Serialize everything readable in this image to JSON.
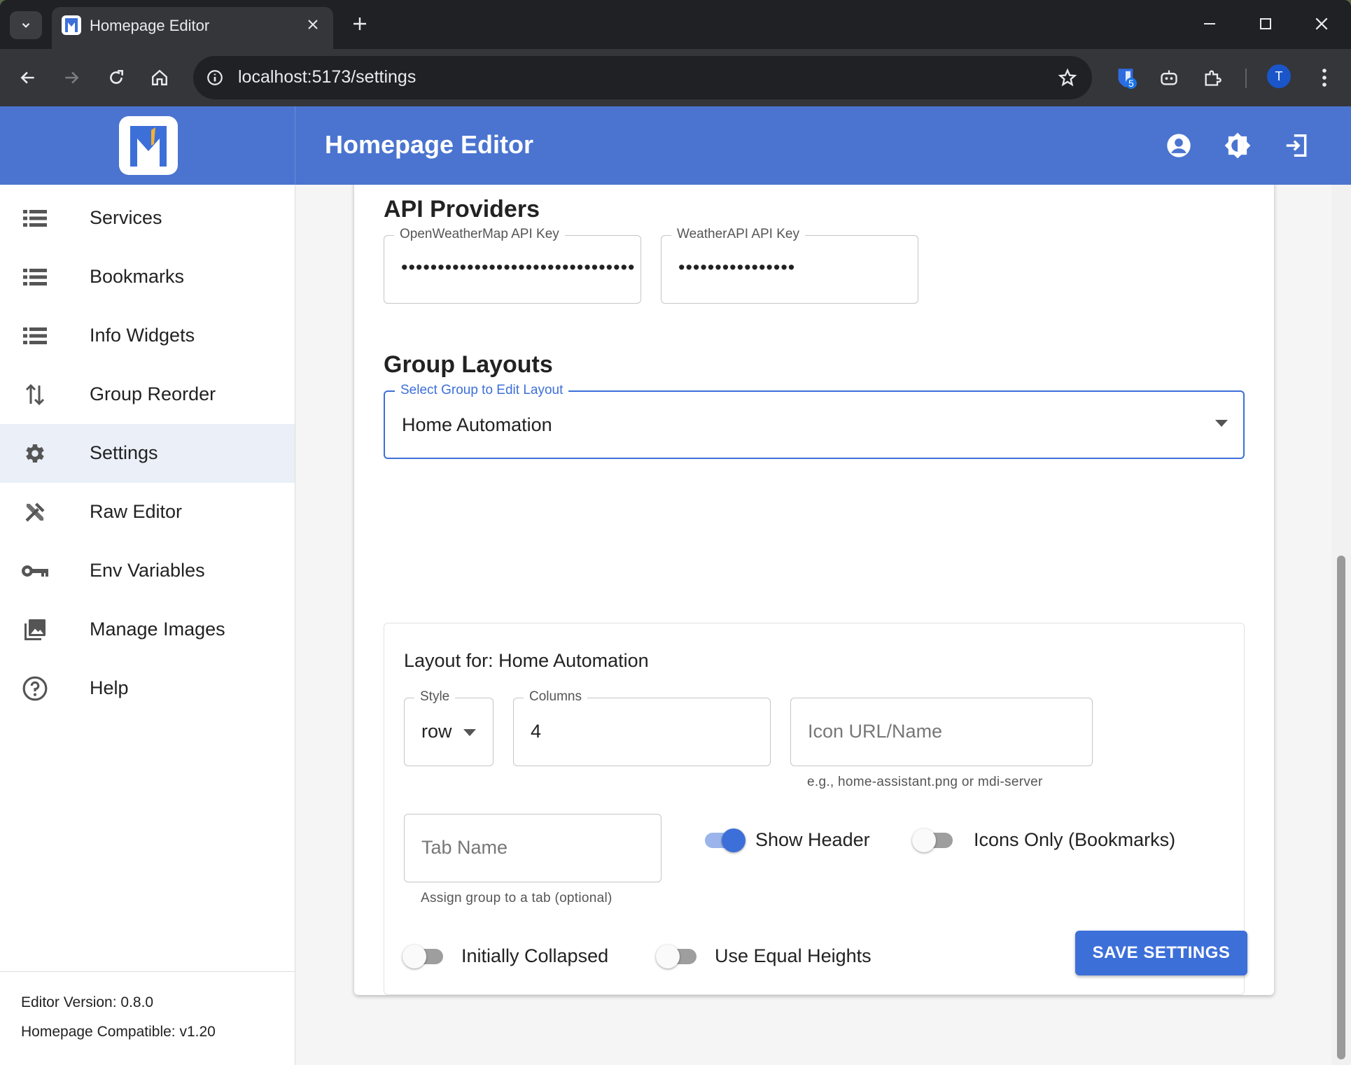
{
  "browser": {
    "tab_title": "Homepage Editor",
    "url": "localhost:5173/settings",
    "extension_badge": "5",
    "profile_initial": "T"
  },
  "app": {
    "title": "Homepage Editor",
    "accent_color": "#4a74d0"
  },
  "sidebar": {
    "items": [
      {
        "label": "Services",
        "icon": "list-icon"
      },
      {
        "label": "Bookmarks",
        "icon": "list-icon"
      },
      {
        "label": "Info Widgets",
        "icon": "list-icon"
      },
      {
        "label": "Group Reorder",
        "icon": "swap-vertical-icon"
      },
      {
        "label": "Settings",
        "icon": "gear-icon"
      },
      {
        "label": "Raw Editor",
        "icon": "tools-icon"
      },
      {
        "label": "Env Variables",
        "icon": "key-icon"
      },
      {
        "label": "Manage Images",
        "icon": "image-icon"
      },
      {
        "label": "Help",
        "icon": "help-circle-icon"
      }
    ],
    "active": "Settings",
    "footer": {
      "editor_version": "Editor Version: 0.8.0",
      "compatible": "Homepage Compatible: v1.20"
    }
  },
  "api_providers": {
    "title": "API Providers",
    "openweathermap": {
      "label": "OpenWeatherMap API Key",
      "value": "••••••••••••••••••••••••••••••••"
    },
    "weatherapi": {
      "label": "WeatherAPI API Key",
      "value": "••••••••••••••••"
    }
  },
  "group_layouts": {
    "title": "Group Layouts",
    "select_label": "Select Group to Edit Layout",
    "selected_group": "Home Automation",
    "layout_title": "Layout for: Home Automation",
    "style": {
      "label": "Style",
      "value": "row"
    },
    "columns": {
      "label": "Columns",
      "value": "4"
    },
    "icon": {
      "placeholder": "Icon URL/Name",
      "helper": "e.g., home-assistant.png or mdi-server"
    },
    "tab_name": {
      "placeholder": "Tab Name",
      "helper": "Assign group to a tab (optional)"
    },
    "show_header": {
      "label": "Show Header",
      "checked": true
    },
    "icons_only": {
      "label": "Icons Only (Bookmarks)",
      "checked": false
    },
    "initially_collapsed": {
      "label": "Initially Collapsed",
      "checked": false
    },
    "equal_heights": {
      "label": "Use Equal Heights",
      "checked": false
    }
  },
  "save_button": "SAVE SETTINGS"
}
